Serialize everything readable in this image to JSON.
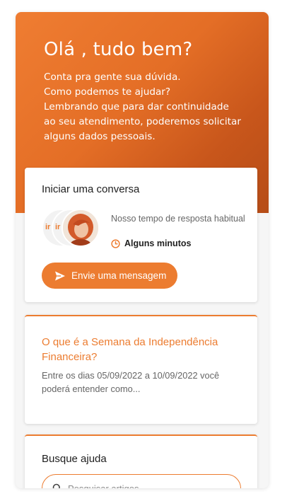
{
  "hero": {
    "title": "Olá , tudo bem?",
    "lines": [
      "Conta pra gente sua dúvida.",
      "Como podemos te ajudar?",
      "Lembrando que para dar continuidade",
      "ao seu atendimento, poderemos solicitar",
      "alguns dados pessoais."
    ]
  },
  "conversation": {
    "title": "Iniciar uma conversa",
    "response_label": "Nosso tempo de resposta habitual",
    "response_time": "Alguns minutos",
    "send_button": "Envie uma mensagem"
  },
  "article": {
    "title": "O que é a Semana da Independência Financeira?",
    "excerpt": "Entre os dias 05/09/2022 a 10/09/2022 você poderá entender como..."
  },
  "help": {
    "title": "Busque ajuda",
    "search_placeholder": "Pesquisar artigos"
  },
  "icons": {
    "clock": "clock-icon",
    "send": "send-icon",
    "search": "search-icon"
  },
  "colors": {
    "accent": "#ec7c30",
    "hero_dark": "#b64d18"
  }
}
